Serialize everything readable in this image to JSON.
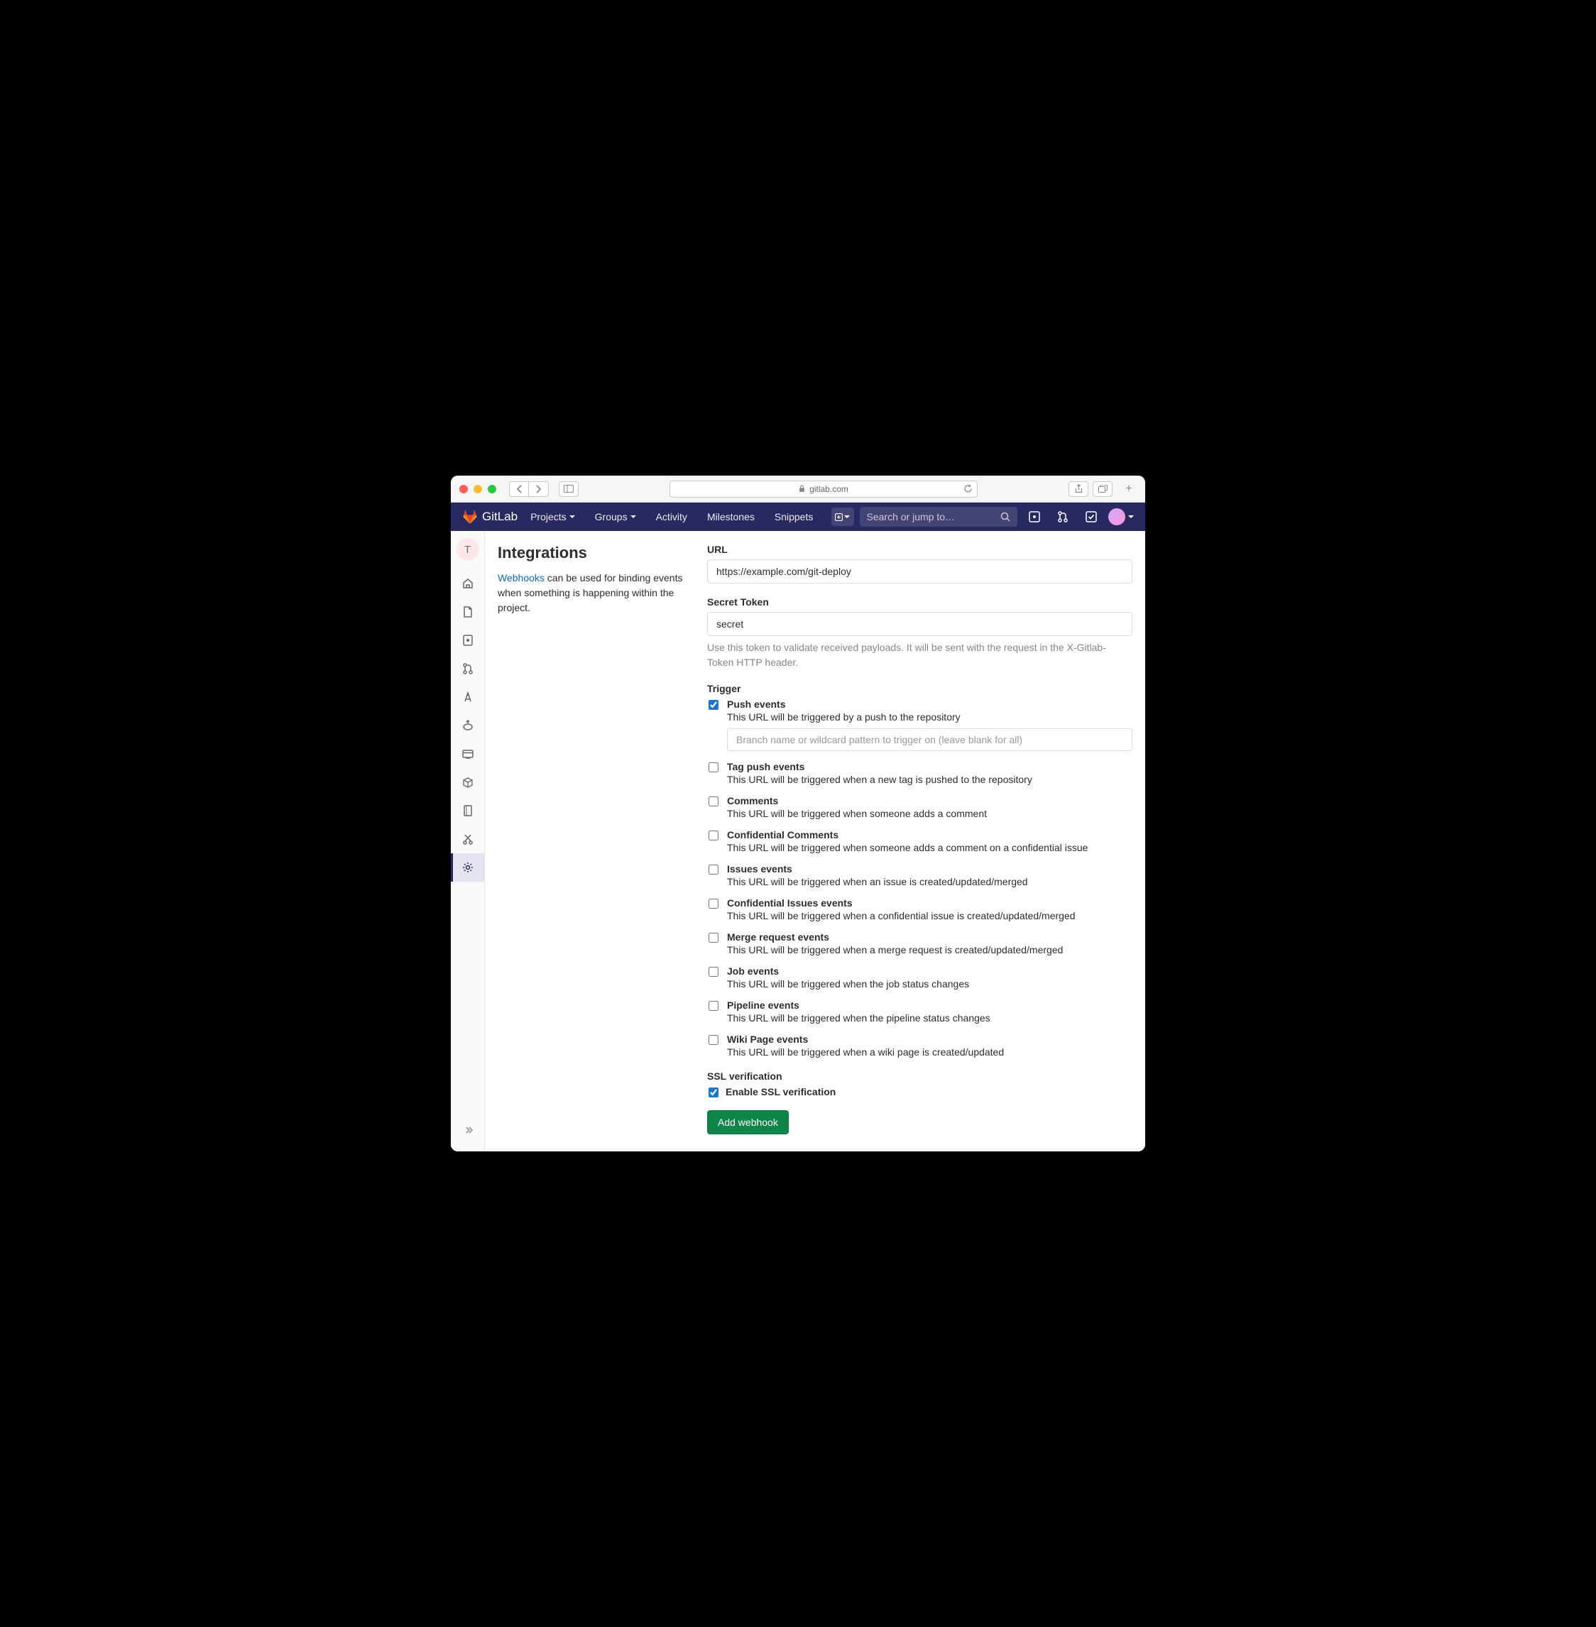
{
  "browser": {
    "url": "gitlab.com"
  },
  "navbar": {
    "brand": "GitLab",
    "projects": "Projects",
    "groups": "Groups",
    "activity": "Activity",
    "milestones": "Milestones",
    "snippets": "Snippets",
    "search_placeholder": "Search or jump to…"
  },
  "rail": {
    "project_letter": "T"
  },
  "page": {
    "title": "Integrations",
    "link_text": "Webhooks",
    "description_rest": " can be used for binding events when something is happening within the project."
  },
  "form": {
    "url_label": "URL",
    "url_value": "https://example.com/git-deploy",
    "token_label": "Secret Token",
    "token_value": "secret",
    "token_help": "Use this token to validate received payloads. It will be sent with the request in the X-Gitlab-Token HTTP header.",
    "trigger_label": "Trigger",
    "branch_placeholder": "Branch name or wildcard pattern to trigger on (leave blank for all)",
    "ssl_heading": "SSL verification",
    "ssl_label": "Enable SSL verification",
    "submit": "Add webhook"
  },
  "triggers": [
    {
      "title": "Push events",
      "desc": "This URL will be triggered by a push to the repository",
      "checked": true,
      "has_input": true
    },
    {
      "title": "Tag push events",
      "desc": "This URL will be triggered when a new tag is pushed to the repository",
      "checked": false
    },
    {
      "title": "Comments",
      "desc": "This URL will be triggered when someone adds a comment",
      "checked": false
    },
    {
      "title": "Confidential Comments",
      "desc": "This URL will be triggered when someone adds a comment on a confidential issue",
      "checked": false
    },
    {
      "title": "Issues events",
      "desc": "This URL will be triggered when an issue is created/updated/merged",
      "checked": false
    },
    {
      "title": "Confidential Issues events",
      "desc": "This URL will be triggered when a confidential issue is created/updated/merged",
      "checked": false
    },
    {
      "title": "Merge request events",
      "desc": "This URL will be triggered when a merge request is created/updated/merged",
      "checked": false
    },
    {
      "title": "Job events",
      "desc": "This URL will be triggered when the job status changes",
      "checked": false
    },
    {
      "title": "Pipeline events",
      "desc": "This URL will be triggered when the pipeline status changes",
      "checked": false
    },
    {
      "title": "Wiki Page events",
      "desc": "This URL will be triggered when a wiki page is created/updated",
      "checked": false
    }
  ]
}
